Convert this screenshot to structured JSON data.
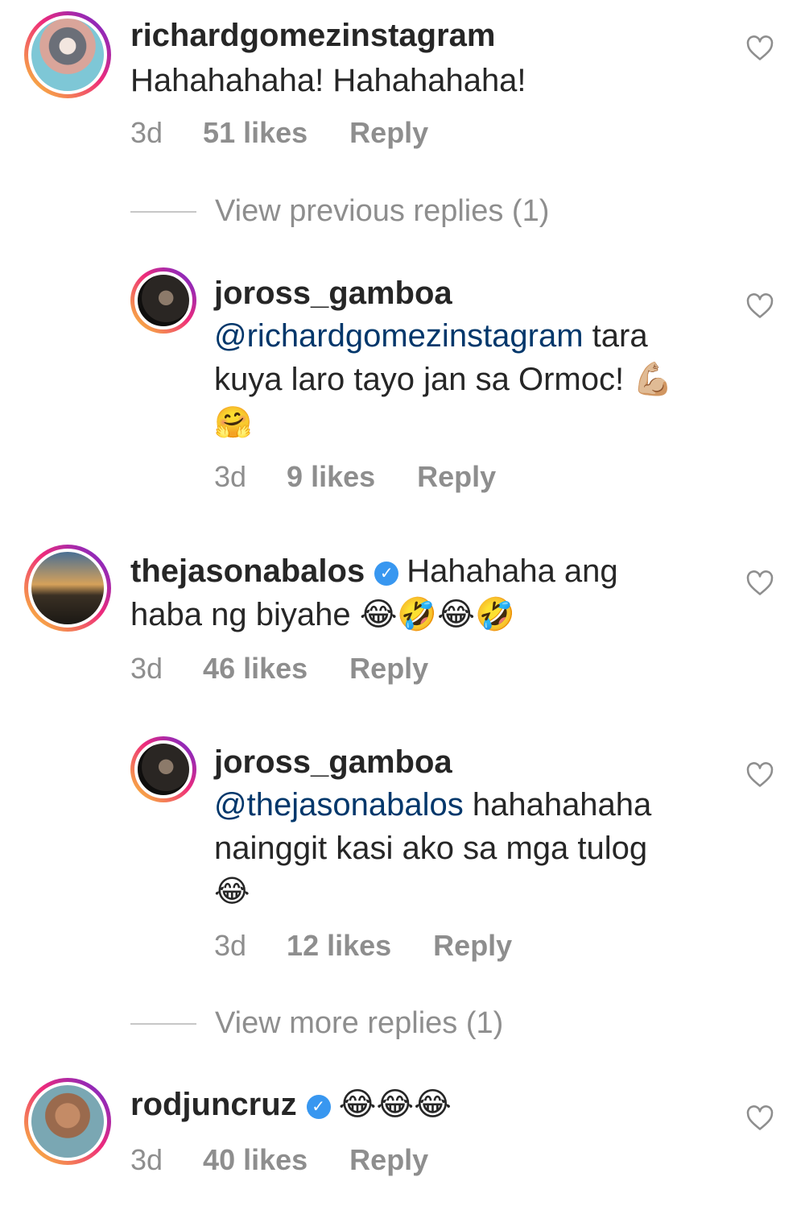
{
  "comments": [
    {
      "username": "richardgomezinstagram",
      "text": "Hahahahaha! Hahahahaha!",
      "time": "3d",
      "likes": "51 likes",
      "reply": "Reply"
    },
    {
      "view_replies": "View previous replies (1)"
    },
    {
      "username": "joross_gamboa",
      "mention": "@richardgomezinstagram",
      "text_line1": " tara",
      "text_line2": "kuya laro tayo jan sa Ormoc! 💪🏼",
      "text_line3": "🤗",
      "time": "3d",
      "likes": "9 likes",
      "reply": "Reply"
    },
    {
      "username": "thejasonabalos",
      "text_line1": "Hahahaha ang",
      "text_line2": "haba ng biyahe 😂🤣😂🤣",
      "time": "3d",
      "likes": "46 likes",
      "reply": "Reply"
    },
    {
      "username": "joross_gamboa",
      "mention": "@thejasonabalos",
      "text_line1": " hahahahaha",
      "text_line2": "nainggit kasi ako sa mga tulog",
      "text_line3": "😂",
      "time": "3d",
      "likes": "12 likes",
      "reply": "Reply"
    },
    {
      "view_replies": "View more replies (1)"
    },
    {
      "username": "rodjuncruz",
      "text": "😂😂😂",
      "time": "3d",
      "likes": "40 likes",
      "reply": "Reply"
    }
  ],
  "icons": {
    "like": "heart-outline-icon",
    "verified": "verified-badge-icon"
  },
  "colors": {
    "mention": "#00376b",
    "secondary_text": "#8e8e8e",
    "verified": "#3897f0"
  }
}
